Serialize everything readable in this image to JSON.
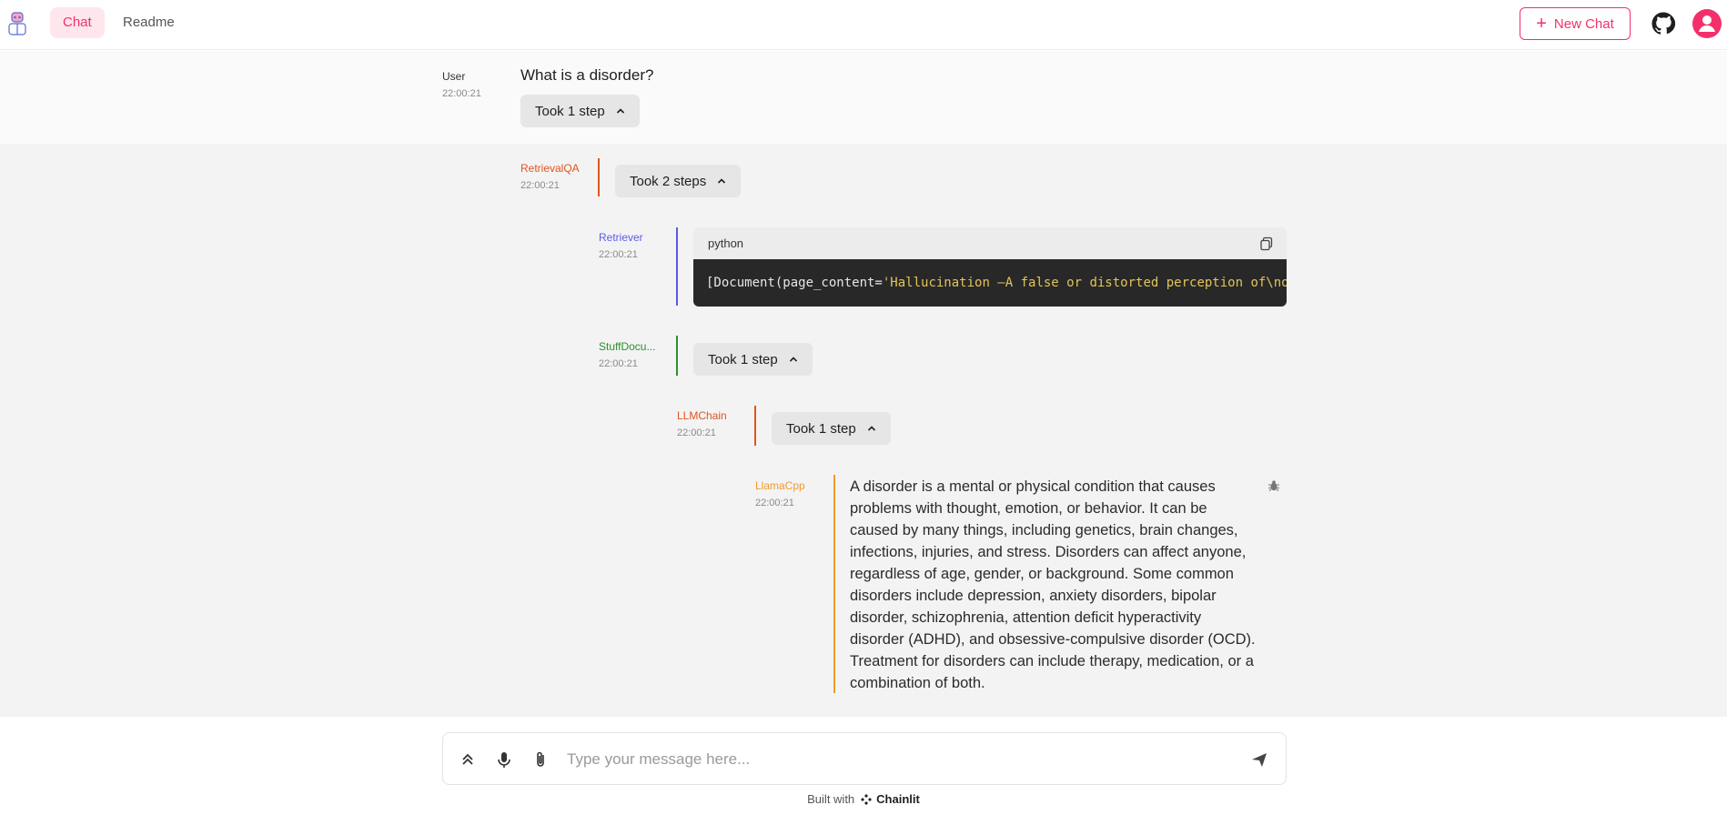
{
  "header": {
    "tabs": [
      {
        "label": "Chat"
      },
      {
        "label": "Readme"
      }
    ],
    "new_chat_label": "New Chat"
  },
  "messages": {
    "user": {
      "author": "User",
      "time": "22:00:21",
      "text": "What is a disorder?",
      "steps": "Took 1 step"
    },
    "retrievalqa": {
      "author": "RetrievalQA",
      "time": "22:00:21",
      "steps": "Took 2 steps"
    },
    "retriever": {
      "author": "Retriever",
      "time": "22:00:21",
      "code_lang": "python",
      "code_prefix": "[Document(page_content=",
      "code_string": "'Hallucination —A false or distorted perception of\\no"
    },
    "stuff": {
      "author": "StuffDocu...",
      "time": "22:00:21",
      "steps": "Took 1 step"
    },
    "llmchain": {
      "author": "LLMChain",
      "time": "22:00:21",
      "steps": "Took 1 step"
    },
    "llamacpp": {
      "author": "LlamaCpp",
      "time": "22:00:21",
      "text": "A disorder is a mental or physical condition that causes problems with thought, emotion, or behavior. It can be caused by many things, including genetics, brain changes, infections, injuries, and stress. Disorders can affect anyone, regardless of age, gender, or background. Some common disorders include depression, anxiety disorders, bipolar disorder, schizophrenia, attention deficit hyperactivity disorder (ADHD), and obsessive-compulsive disorder (OCD). Treatment for disorders can include therapy, medication, or a combination of both."
    }
  },
  "composer": {
    "placeholder": "Type your message here..."
  },
  "footer": {
    "built_with": "Built with",
    "brand": "Chainlit"
  },
  "colors": {
    "accent": "#f3306a",
    "retrievalqa": "#e0561e",
    "retriever": "#5b5be6",
    "stuff": "#2e8f2e",
    "llmchain": "#e0561e",
    "llamacpp": "#f29a2a"
  },
  "icons": {
    "logo": "robot-logo-icon",
    "github": "github-icon",
    "avatar": "user-avatar-icon",
    "copy": "copy-icon",
    "bug": "bug-icon",
    "expand": "chevrons-up-icon",
    "mic": "microphone-icon",
    "attach": "paperclip-icon",
    "send": "send-icon"
  }
}
